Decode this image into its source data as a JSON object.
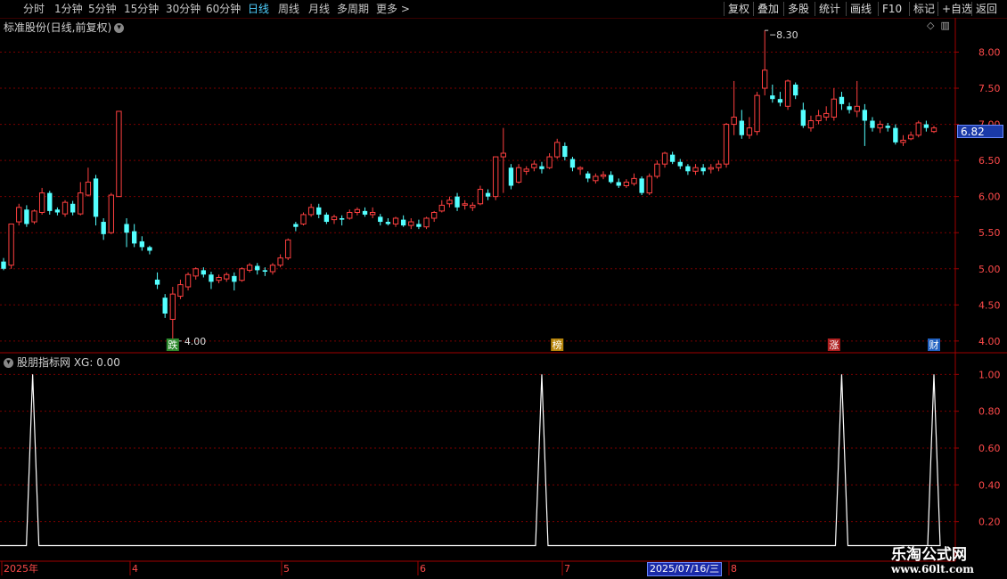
{
  "toolbar": {
    "left": [
      "分时",
      "1分钟",
      "5分钟",
      "15分钟",
      "30分钟",
      "60分钟",
      "日线",
      "周线",
      "月线",
      "多周期",
      "更多 >"
    ],
    "active": "日线",
    "right": [
      "复权",
      "叠加",
      "多股",
      "统计",
      "画线",
      "F10",
      "标记",
      "+自选",
      "返回"
    ]
  },
  "main_chart": {
    "title": "标准股份(日线,前复权)",
    "current_price": "6.82",
    "high_label": "8.30",
    "low_label": "4.00",
    "y_ticks": [
      "8.00",
      "7.50",
      "7.00",
      "6.50",
      "6.00",
      "5.50",
      "5.00",
      "4.50",
      "4.00"
    ],
    "markers": [
      {
        "text": "跌",
        "color": "#2e8b2e"
      },
      {
        "text": "榜",
        "color": "#b8860b"
      },
      {
        "text": "涨",
        "color": "#b02020"
      },
      {
        "text": "财",
        "color": "#2060c0"
      }
    ]
  },
  "indicator": {
    "title": "股朋指标网 XG: 0.00",
    "y_ticks": [
      "1.00",
      "0.80",
      "0.60",
      "0.40",
      "0.20"
    ]
  },
  "x_axis": {
    "labels": [
      "2025年",
      "4",
      "5",
      "6",
      "7",
      "8"
    ],
    "cursor_date": "2025/07/16/三"
  },
  "watermark": {
    "line1": "乐淘公式网",
    "line2": "www.60lt.com"
  },
  "colors": {
    "up": "#ff4040",
    "down": "#54ffff",
    "grid": "#7a0000",
    "axis": "#a00000"
  },
  "chart_data": {
    "type": "candlestick",
    "series_note": "",
    "ohlc": [
      [
        5.1,
        5.0,
        5.15,
        4.98
      ],
      [
        5.05,
        5.62,
        5.62,
        5.0
      ],
      [
        5.65,
        5.85,
        5.9,
        5.6
      ],
      [
        5.82,
        5.62,
        5.88,
        5.58
      ],
      [
        5.65,
        5.8,
        5.82,
        5.62
      ],
      [
        5.78,
        6.05,
        6.12,
        5.75
      ],
      [
        6.05,
        5.8,
        6.08,
        5.75
      ],
      [
        5.82,
        5.78,
        5.85,
        5.74
      ],
      [
        5.76,
        5.92,
        5.95,
        5.72
      ],
      [
        5.9,
        5.78,
        5.94,
        5.74
      ],
      [
        5.76,
        6.05,
        6.2,
        5.74
      ],
      [
        6.02,
        6.2,
        6.4,
        6.0
      ],
      [
        6.25,
        5.72,
        6.3,
        5.6
      ],
      [
        5.65,
        5.48,
        5.7,
        5.4
      ],
      [
        5.5,
        6.02,
        6.05,
        5.48
      ],
      [
        6.0,
        7.18,
        7.18,
        6.0
      ],
      [
        5.62,
        5.5,
        5.7,
        5.3
      ],
      [
        5.52,
        5.35,
        5.62,
        5.3
      ],
      [
        5.38,
        5.3,
        5.45,
        5.25
      ],
      [
        5.3,
        5.25,
        5.32,
        5.2
      ],
      [
        4.85,
        4.78,
        4.95,
        4.72
      ],
      [
        4.6,
        4.38,
        4.65,
        4.32
      ],
      [
        4.3,
        4.65,
        4.75,
        4.0
      ],
      [
        4.62,
        4.78,
        4.85,
        4.58
      ],
      [
        4.75,
        4.92,
        4.95,
        4.7
      ],
      [
        4.9,
        5.0,
        5.02,
        4.85
      ],
      [
        4.98,
        4.92,
        5.02,
        4.88
      ],
      [
        4.92,
        4.82,
        4.96,
        4.72
      ],
      [
        4.84,
        4.88,
        4.92,
        4.8
      ],
      [
        4.86,
        4.92,
        4.95,
        4.82
      ],
      [
        4.9,
        4.82,
        4.95,
        4.7
      ],
      [
        4.84,
        5.0,
        5.02,
        4.82
      ],
      [
        4.98,
        5.05,
        5.08,
        4.95
      ],
      [
        5.04,
        4.98,
        5.08,
        4.92
      ],
      [
        4.98,
        4.96,
        5.02,
        4.9
      ],
      [
        4.96,
        5.05,
        5.08,
        4.92
      ],
      [
        5.05,
        5.15,
        5.2,
        5.02
      ],
      [
        5.15,
        5.4,
        5.42,
        5.12
      ],
      [
        5.62,
        5.58,
        5.65,
        5.52
      ],
      [
        5.62,
        5.75,
        5.78,
        5.6
      ],
      [
        5.75,
        5.85,
        5.9,
        5.72
      ],
      [
        5.85,
        5.75,
        5.9,
        5.7
      ],
      [
        5.75,
        5.65,
        5.78,
        5.62
      ],
      [
        5.68,
        5.72,
        5.75,
        5.62
      ],
      [
        5.7,
        5.68,
        5.74,
        5.6
      ],
      [
        5.7,
        5.78,
        5.82,
        5.68
      ],
      [
        5.78,
        5.82,
        5.85,
        5.74
      ],
      [
        5.8,
        5.75,
        5.85,
        5.72
      ],
      [
        5.75,
        5.78,
        5.85,
        5.7
      ],
      [
        5.72,
        5.65,
        5.76,
        5.6
      ],
      [
        5.65,
        5.62,
        5.7,
        5.6
      ],
      [
        5.62,
        5.7,
        5.72,
        5.58
      ],
      [
        5.68,
        5.6,
        5.74,
        5.58
      ],
      [
        5.6,
        5.65,
        5.7,
        5.55
      ],
      [
        5.62,
        5.58,
        5.68,
        5.55
      ],
      [
        5.58,
        5.7,
        5.72,
        5.55
      ],
      [
        5.7,
        5.78,
        5.8,
        5.65
      ],
      [
        5.8,
        5.88,
        5.95,
        5.78
      ],
      [
        5.9,
        5.95,
        6.0,
        5.85
      ],
      [
        6.0,
        5.85,
        6.05,
        5.8
      ],
      [
        5.88,
        5.9,
        5.95,
        5.82
      ],
      [
        5.85,
        5.88,
        5.92,
        5.8
      ],
      [
        5.9,
        6.1,
        6.15,
        5.88
      ],
      [
        6.05,
        6.0,
        6.1,
        5.95
      ],
      [
        6.0,
        6.55,
        6.55,
        5.95
      ],
      [
        6.55,
        6.6,
        6.95,
        6.05
      ],
      [
        6.4,
        6.15,
        6.45,
        6.1
      ],
      [
        6.2,
        6.4,
        6.45,
        6.18
      ],
      [
        6.35,
        6.38,
        6.42,
        6.3
      ],
      [
        6.4,
        6.45,
        6.5,
        6.35
      ],
      [
        6.42,
        6.38,
        6.48,
        6.32
      ],
      [
        6.4,
        6.55,
        6.6,
        6.38
      ],
      [
        6.55,
        6.75,
        6.8,
        6.52
      ],
      [
        6.7,
        6.55,
        6.75,
        6.5
      ],
      [
        6.52,
        6.4,
        6.55,
        6.35
      ],
      [
        6.38,
        6.4,
        6.42,
        6.3
      ],
      [
        6.32,
        6.25,
        6.35,
        6.2
      ],
      [
        6.22,
        6.28,
        6.32,
        6.18
      ],
      [
        6.28,
        6.3,
        6.35,
        6.24
      ],
      [
        6.3,
        6.2,
        6.35,
        6.18
      ],
      [
        6.2,
        6.15,
        6.25,
        6.12
      ],
      [
        6.15,
        6.2,
        6.24,
        6.12
      ],
      [
        6.18,
        6.25,
        6.32,
        6.15
      ],
      [
        6.25,
        6.05,
        6.28,
        6.02
      ],
      [
        6.05,
        6.28,
        6.32,
        6.02
      ],
      [
        6.28,
        6.45,
        6.5,
        6.25
      ],
      [
        6.45,
        6.6,
        6.62,
        6.4
      ],
      [
        6.58,
        6.48,
        6.62,
        6.45
      ],
      [
        6.48,
        6.42,
        6.52,
        6.38
      ],
      [
        6.42,
        6.35,
        6.45,
        6.3
      ],
      [
        6.35,
        6.4,
        6.45,
        6.3
      ],
      [
        6.4,
        6.35,
        6.45,
        6.3
      ],
      [
        6.38,
        6.4,
        6.45,
        6.32
      ],
      [
        6.4,
        6.45,
        6.5,
        6.35
      ],
      [
        6.45,
        7.0,
        7.02,
        6.4
      ],
      [
        7.0,
        7.1,
        7.6,
        6.85
      ],
      [
        7.05,
        6.85,
        7.2,
        6.8
      ],
      [
        6.85,
        6.95,
        7.1,
        6.8
      ],
      [
        6.9,
        7.4,
        7.45,
        6.85
      ],
      [
        7.5,
        7.75,
        8.3,
        7.4
      ],
      [
        7.4,
        7.35,
        7.55,
        7.3
      ],
      [
        7.35,
        7.3,
        7.45,
        7.25
      ],
      [
        7.25,
        7.6,
        7.62,
        7.2
      ],
      [
        7.55,
        7.4,
        7.58,
        7.35
      ],
      [
        7.2,
        6.98,
        7.3,
        6.95
      ],
      [
        6.95,
        7.05,
        7.12,
        6.9
      ],
      [
        7.05,
        7.12,
        7.2,
        7.0
      ],
      [
        7.1,
        7.15,
        7.25,
        7.05
      ],
      [
        7.1,
        7.35,
        7.5,
        7.05
      ],
      [
        7.38,
        7.28,
        7.45,
        7.2
      ],
      [
        7.25,
        7.2,
        7.3,
        7.15
      ],
      [
        7.18,
        7.25,
        7.6,
        7.1
      ],
      [
        7.2,
        7.05,
        7.28,
        6.7
      ],
      [
        7.05,
        6.95,
        7.1,
        6.9
      ],
      [
        6.95,
        7.0,
        7.05,
        6.88
      ],
      [
        6.98,
        6.95,
        7.02,
        6.9
      ],
      [
        6.95,
        6.75,
        7.0,
        6.72
      ],
      [
        6.75,
        6.78,
        6.85,
        6.7
      ],
      [
        6.8,
        6.85,
        6.9,
        6.78
      ],
      [
        6.85,
        7.02,
        7.05,
        6.82
      ],
      [
        7.0,
        6.95,
        7.05,
        6.9
      ],
      [
        6.9,
        6.95,
        6.98,
        6.88
      ]
    ],
    "xg_peaks_index": [
      1,
      70,
      109,
      121
    ],
    "ylim": [
      3.85,
      8.45
    ],
    "indicator_ylim": [
      0,
      1.05
    ]
  }
}
